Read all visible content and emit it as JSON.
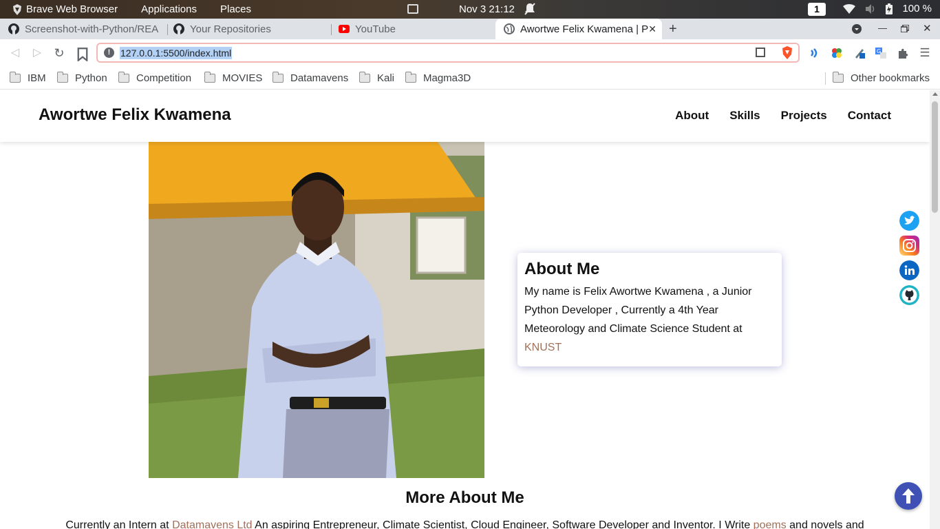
{
  "os_panel": {
    "app_name": "Brave Web Browser",
    "menu_applications": "Applications",
    "menu_places": "Places",
    "clock": "Nov 3  21:12",
    "workspace": "1",
    "battery": "100 %"
  },
  "tabs": [
    {
      "label": "Screenshot-with-Python/REA",
      "favicon": "github-icon",
      "active": false
    },
    {
      "label": "Your Repositories",
      "favicon": "github-icon",
      "active": false
    },
    {
      "label": "YouTube",
      "favicon": "youtube-icon",
      "active": false
    },
    {
      "label": "Awortwe Felix Kwamena | P",
      "favicon": "globe-icon",
      "active": true
    }
  ],
  "toolbar": {
    "url": "127.0.0.1:5500/index.html"
  },
  "bookmarks": {
    "items": [
      "IBM",
      "Python",
      "Competition",
      "MOVIES",
      "Datamavens",
      "Kali",
      "Magma3D"
    ],
    "other": "Other bookmarks"
  },
  "site": {
    "title": "Awortwe Felix Kwamena",
    "nav": [
      "About",
      "Skills",
      "Projects",
      "Contact"
    ],
    "about": {
      "heading": "About Me",
      "text": "My name is Felix Awortwe Kwamena , a Junior Python Developer , Currently a 4th Year Meteorology and Climate Science Student at ",
      "link": "KNUST"
    },
    "more": {
      "heading": "More About Me",
      "text_1": "Currently an Intern at ",
      "link_1": "Datamavens Ltd",
      "text_2": " An aspiring Entrepreneur, Climate Scientist, Cloud Engineer, Software Developer and Inventor. I Write ",
      "link_2": "poems",
      "text_3": " and novels and"
    },
    "social": [
      "twitter-icon",
      "instagram-icon",
      "linkedin-icon",
      "github-icon"
    ]
  },
  "colors": {
    "accent_link": "#a0705a",
    "back_to_top": "#3f51b5",
    "twitter": "#1da1f2",
    "linkedin": "#0a66c2"
  }
}
